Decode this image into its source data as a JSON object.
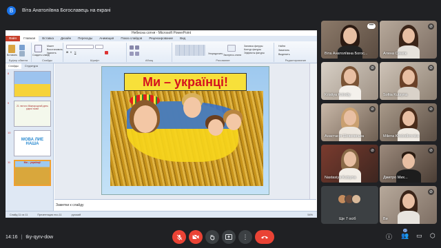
{
  "presenter": {
    "avatar_letter": "В",
    "label": "Віта Анатоліївна Богославець на екрані"
  },
  "powerpoint": {
    "window_title": "Небесна сотня - Microsoft PowerPoint",
    "tabs": [
      "Файл",
      "Главная",
      "Вставка",
      "Дизайн",
      "Переходы",
      "Анимация",
      "Показ слайдов",
      "Рецензирование",
      "Вид"
    ],
    "ribbon_groups": [
      "Буфер обмена",
      "Слайды",
      "Шрифт",
      "Абзац",
      "Рисование",
      "Редактирование"
    ],
    "ribbon_buttons": {
      "paste": "Вставить",
      "create_slide": "Создать слайд",
      "layout": "Макет",
      "restore": "Восстановить",
      "delete": "Удалить",
      "arrange": "Упорядочить",
      "quick_styles": "Экспресс-стили",
      "find": "Найти",
      "replace": "Заменить",
      "select": "Выделить",
      "shape_fill": "Заливка фигуры",
      "shape_outline": "Контур фигуры",
      "shape_effects": "Эффекты фигуры"
    },
    "left_tabs": [
      "Слайды",
      "Структура"
    ],
    "thumbnails": [
      {
        "num": "8"
      },
      {
        "num": "9",
        "text": "21 лютого Міжнародний день рідної мови"
      },
      {
        "num": "10",
        "text": "МОВА ЛИЕ НАША"
      },
      {
        "num": "11",
        "text": "Ми – українці!"
      }
    ],
    "slide_title": "Ми – українці!",
    "notes_placeholder": "Заметки к слайду",
    "status": {
      "slide": "Слайд 11 из 11",
      "theme": "Презентация eco-11",
      "lang": "русский",
      "zoom": "54%"
    }
  },
  "participants": [
    {
      "name": "Віта Анатоліївна Богос..."
    },
    {
      "name": "Алена Синюк"
    },
    {
      "name": "Kristiya Kolodiy"
    },
    {
      "name": "Sofiia Kutsyna"
    },
    {
      "name": "Анастасія Шевковська"
    },
    {
      "name": "Milena Kholodkovska"
    },
    {
      "name": "Nastasiya Kutsyna"
    },
    {
      "name": "Дмитро Мих..."
    },
    {
      "name": "Ще 7 осіб"
    },
    {
      "name": "Ви"
    }
  ],
  "bottom": {
    "time": "14:16",
    "separator": "|",
    "meeting_code": "tky-qyrv-dow",
    "participants_count": "17"
  },
  "icons": {
    "mic_off": "mic-off-icon",
    "cam_off": "camera-off-icon",
    "hand": "raise-hand-icon",
    "present": "present-icon",
    "more": "more-options-icon",
    "hangup": "hang-up-icon",
    "info": "info-icon",
    "people": "people-icon",
    "chat": "chat-icon",
    "activities": "activities-icon"
  }
}
